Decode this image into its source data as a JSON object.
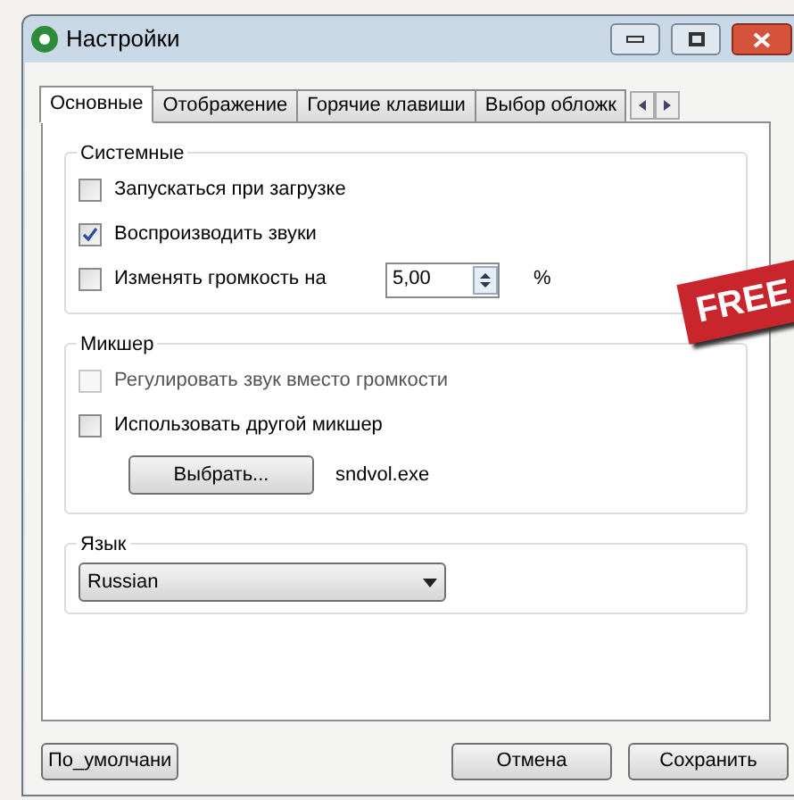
{
  "window": {
    "title": "Настройки"
  },
  "tabs": [
    {
      "label": "Основные",
      "selected": true
    },
    {
      "label": "Отображение",
      "selected": false
    },
    {
      "label": "Горячие клавиши",
      "selected": false
    },
    {
      "label": "Выбор обложк",
      "selected": false
    }
  ],
  "groups": [
    {
      "title": "Системные",
      "items": [
        {
          "kind": "checkbox",
          "label": "Запускаться при загрузке",
          "checked": false,
          "disabled": false
        },
        {
          "kind": "checkbox",
          "label": "Воспроизводить звуки",
          "checked": true,
          "disabled": false
        },
        {
          "kind": "spin",
          "label": "Изменять громкость на",
          "checked": false,
          "disabled": false,
          "value": "5,00",
          "unit": "%"
        }
      ]
    },
    {
      "title": "Микшер",
      "items": [
        {
          "kind": "checkbox",
          "label": "Регулировать звук вместо громкости",
          "checked": false,
          "disabled": true
        },
        {
          "kind": "checkbox",
          "label": "Использовать другой микшер",
          "checked": false,
          "disabled": false
        },
        {
          "kind": "picker",
          "button": "Выбрать...",
          "value": "sndvol.exe"
        }
      ]
    },
    {
      "title": "Язык",
      "items": [
        {
          "kind": "select",
          "value": "Russian"
        }
      ]
    }
  ],
  "badge": "FREE",
  "buttons": {
    "left": "По_умолчани",
    "right": [
      "Отмена",
      "Сохранить"
    ]
  }
}
